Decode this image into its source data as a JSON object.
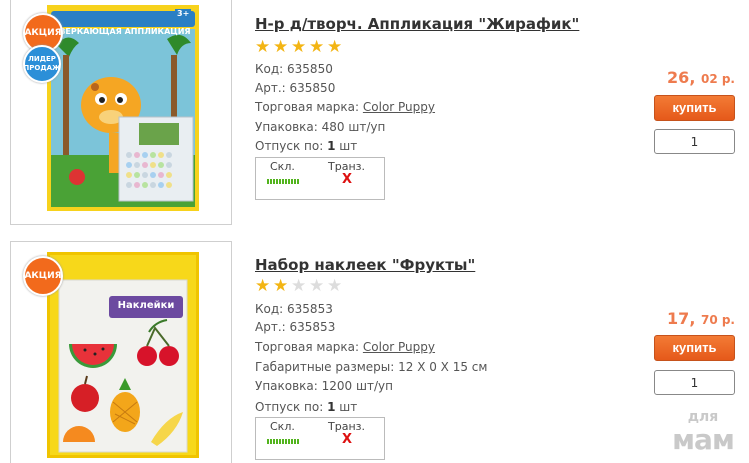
{
  "products": [
    {
      "title": "Н-р д/творч. Аппликация \"Жирафик\"",
      "rating": 5,
      "max_rating": 5,
      "badge_sale": "АКЦИЯ",
      "badge_lead": "ЛИДЕР ПРОДАЖ",
      "image_caption": "СВЕРКАЮЩАЯ АППЛИКАЦИЯ",
      "image_age": "3+",
      "code_label": "Код:",
      "code": "635850",
      "art_label": "Арт.:",
      "art": "635850",
      "brand_label": "Торговая марка:",
      "brand": "Color Puppy",
      "pack_label": "Упаковка:",
      "pack": "480 шт/уп",
      "min_label": "Отпуск по:",
      "min_qty": "1",
      "min_unit": "шт",
      "stock_label": "Скл.",
      "transit_label": "Транз.",
      "transit_mark": "X",
      "price_rub": "26,",
      "price_kop": "02 р.",
      "buy_label": "купить",
      "qty_value": "1"
    },
    {
      "title": "Набор наклеек \"Фрукты\"",
      "rating": 2,
      "max_rating": 5,
      "badge_sale": "АКЦИЯ",
      "image_caption": "Наклейки",
      "code_label": "Код:",
      "code": "635853",
      "art_label": "Арт.:",
      "art": "635853",
      "brand_label": "Торговая марка:",
      "brand": "Color Puppy",
      "dims_label": "Габаритные размеры:",
      "dims": "12 X 0 X 15 см",
      "pack_label": "Упаковка:",
      "pack": "1200 шт/уп",
      "min_label": "Отпуск по:",
      "min_qty": "1",
      "min_unit": "шт",
      "stock_label": "Скл.",
      "transit_label": "Транз.",
      "transit_mark": "X",
      "price_rub": "17,",
      "price_kop": "70 р.",
      "buy_label": "купить",
      "qty_value": "1"
    }
  ],
  "watermark": {
    "line1": "для",
    "line2": "мам"
  },
  "colors": {
    "accent": "#f26a1c",
    "price": "#ee7b4e",
    "star": "#f3b514",
    "stock_bar": "#52b41d",
    "cross": "#dd1111"
  }
}
